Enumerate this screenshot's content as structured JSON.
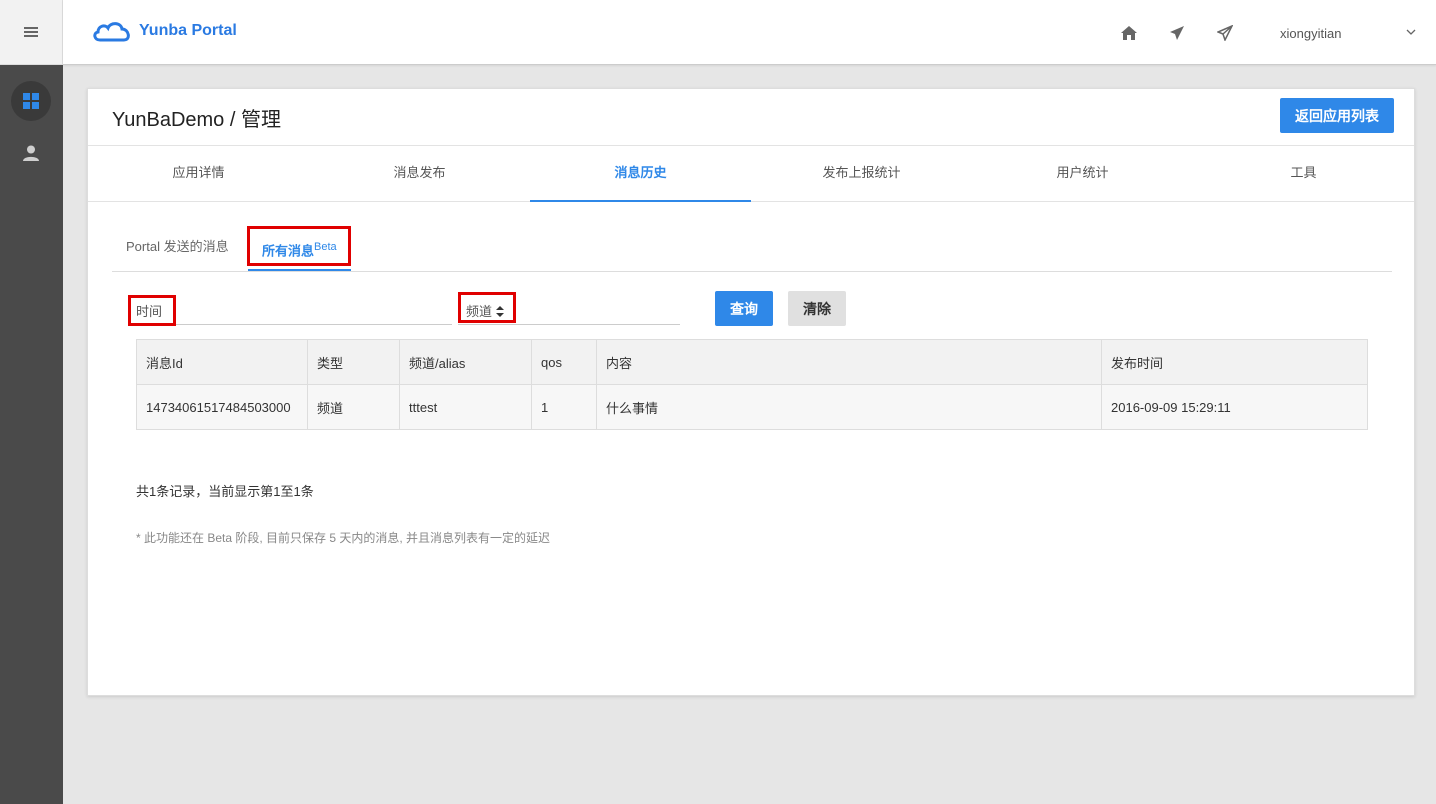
{
  "header": {
    "logo_text": "Yunba Portal",
    "username": "xiongyitian",
    "icons": [
      "home-icon",
      "send-icon",
      "send-outline-icon",
      "chevron-down-icon"
    ]
  },
  "sidebar": {
    "items": [
      {
        "icon": "dashboard-icon",
        "active": true
      },
      {
        "icon": "user-icon",
        "active": false
      }
    ]
  },
  "card": {
    "title": "YunBaDemo / 管理",
    "back_button": "返回应用列表"
  },
  "tabs": [
    {
      "label": "应用详情",
      "active": false
    },
    {
      "label": "消息发布",
      "active": false
    },
    {
      "label": "消息历史",
      "active": true
    },
    {
      "label": "发布上报统计",
      "active": false
    },
    {
      "label": "用户统计",
      "active": false
    },
    {
      "label": "工具",
      "active": false
    }
  ],
  "subtabs": {
    "portal": "Portal 发送的消息",
    "all": "所有消息",
    "all_sup": "Beta"
  },
  "filters": {
    "time_label": "时间",
    "channel_label": "频道",
    "sort_icon": "sort-icon",
    "query_button": "查询",
    "clear_button": "清除"
  },
  "table": {
    "headers": [
      "消息Id",
      "类型",
      "频道/alias",
      "qos",
      "内容",
      "发布时间"
    ],
    "rows": [
      [
        "14734061517484503000",
        "频道",
        "tttest",
        "1",
        "什么事情",
        "2016-09-09 15:29:11"
      ]
    ]
  },
  "summary": "共1条记录，当前显示第1至1条",
  "note": "* 此功能还在 Beta 阶段, 目前只保存 5 天内的消息, 并且消息列表有一定的延迟",
  "colors": {
    "accent": "#2f88e8",
    "highlight": "#e00000",
    "sidebar": "#4a4a4a"
  }
}
